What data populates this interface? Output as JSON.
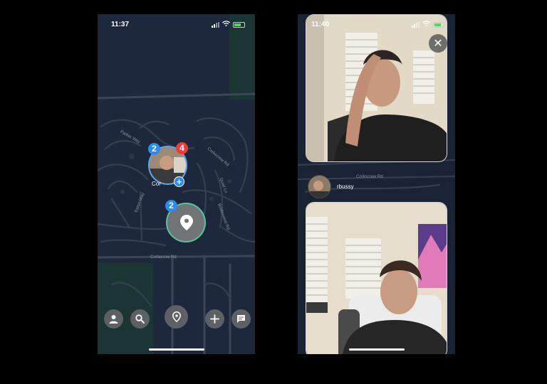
{
  "left_phone": {
    "status": {
      "time": "11:37"
    },
    "map": {
      "road_labels": [
        "Cortacrow Rd",
        "Corkscrew Rd",
        "Quail Ln",
        "Eaton Way",
        "Parker Way",
        "Bridlewood Rd"
      ]
    },
    "friend_pin": {
      "label": "Cor",
      "friend_count": "2",
      "notification_count": "4",
      "add_symbol": "+"
    },
    "place_pin": {
      "count": "2"
    },
    "nav": {
      "profile_icon": "person-icon",
      "search_icon": "search-icon",
      "location_icon": "location-pin-icon",
      "add_icon": "plus-icon",
      "chat_icon": "chat-icon"
    },
    "colors": {
      "map_bg": "#1d283c",
      "badge_blue": "#2c8df0",
      "badge_red": "#ee3b3b",
      "place_ring": "#58c39a"
    }
  },
  "right_phone": {
    "status": {
      "time": "11:40"
    },
    "close_symbol": "✕",
    "road_label": "Corkscrew Rd",
    "user": {
      "username": "rbussy"
    }
  }
}
